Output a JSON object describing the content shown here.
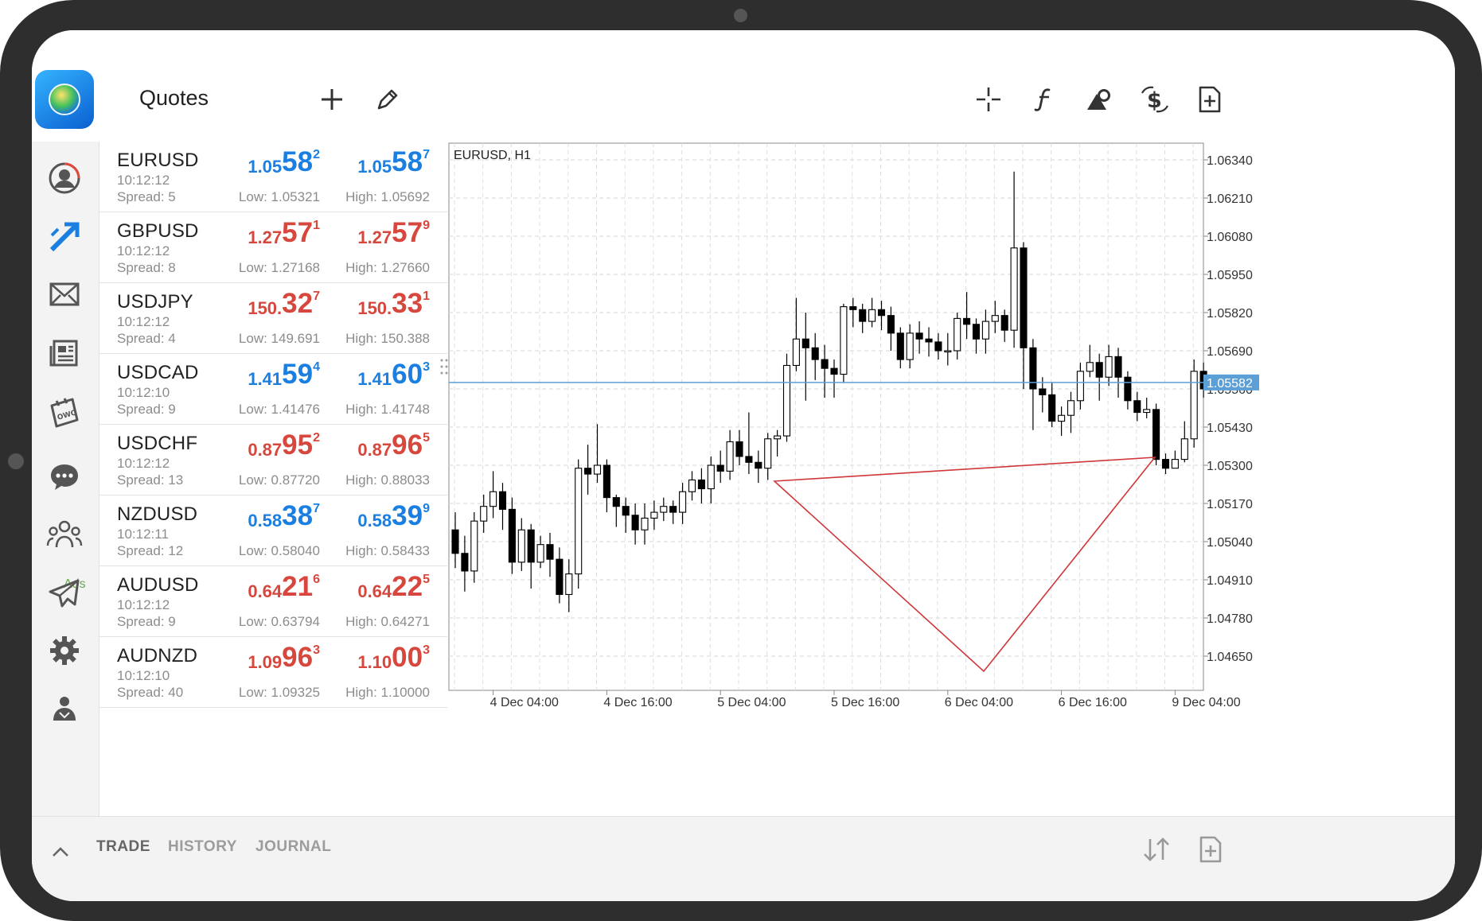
{
  "header": {
    "title": "Quotes",
    "left_icons": [
      "add-icon",
      "edit-icon"
    ],
    "right_icons": [
      "crosshair-icon",
      "indicators-icon",
      "objects-icon",
      "trade-icon",
      "new-order-icon"
    ]
  },
  "nav": {
    "items": [
      "account-icon",
      "trading-icon",
      "mail-icon",
      "news-icon",
      "ads-icon",
      "chat-icon",
      "community-icon",
      "telegram-icon",
      "settings-icon",
      "traders-icon"
    ],
    "ads_label": "Ads"
  },
  "quotes": [
    {
      "symbol": "EURUSD",
      "time": "10:12:12",
      "spread": "Spread: 5",
      "bid": {
        "a": "1.05",
        "b": "58",
        "c": "2"
      },
      "ask": {
        "a": "1.05",
        "b": "58",
        "c": "7"
      },
      "low": "Low: 1.05321",
      "high": "High: 1.05692",
      "color": "#1a7fe0"
    },
    {
      "symbol": "GBPUSD",
      "time": "10:12:12",
      "spread": "Spread: 8",
      "bid": {
        "a": "1.27",
        "b": "57",
        "c": "1"
      },
      "ask": {
        "a": "1.27",
        "b": "57",
        "c": "9"
      },
      "low": "Low: 1.27168",
      "high": "High: 1.27660",
      "color": "#d7473d"
    },
    {
      "symbol": "USDJPY",
      "time": "10:12:12",
      "spread": "Spread: 4",
      "bid": {
        "a": "150.",
        "b": "32",
        "c": "7"
      },
      "ask": {
        "a": "150.",
        "b": "33",
        "c": "1"
      },
      "low": "Low: 149.691",
      "high": "High: 150.388",
      "color": "#d7473d"
    },
    {
      "symbol": "USDCAD",
      "time": "10:12:10",
      "spread": "Spread: 9",
      "bid": {
        "a": "1.41",
        "b": "59",
        "c": "4"
      },
      "ask": {
        "a": "1.41",
        "b": "60",
        "c": "3"
      },
      "low": "Low: 1.41476",
      "high": "High: 1.41748",
      "color": "#1a7fe0"
    },
    {
      "symbol": "USDCHF",
      "time": "10:12:12",
      "spread": "Spread: 13",
      "bid": {
        "a": "0.87",
        "b": "95",
        "c": "2"
      },
      "ask": {
        "a": "0.87",
        "b": "96",
        "c": "5"
      },
      "low": "Low: 0.87720",
      "high": "High: 0.88033",
      "color": "#d7473d"
    },
    {
      "symbol": "NZDUSD",
      "time": "10:12:11",
      "spread": "Spread: 12",
      "bid": {
        "a": "0.58",
        "b": "38",
        "c": "7"
      },
      "ask": {
        "a": "0.58",
        "b": "39",
        "c": "9"
      },
      "low": "Low: 0.58040",
      "high": "High: 0.58433",
      "color": "#1a7fe0"
    },
    {
      "symbol": "AUDUSD",
      "time": "10:12:12",
      "spread": "Spread: 9",
      "bid": {
        "a": "0.64",
        "b": "21",
        "c": "6"
      },
      "ask": {
        "a": "0.64",
        "b": "22",
        "c": "5"
      },
      "low": "Low: 0.63794",
      "high": "High: 0.64271",
      "color": "#d7473d"
    },
    {
      "symbol": "AUDNZD",
      "time": "10:12:10",
      "spread": "Spread: 40",
      "bid": {
        "a": "1.09",
        "b": "96",
        "c": "3"
      },
      "ask": {
        "a": "1.10",
        "b": "00",
        "c": "3"
      },
      "low": "Low: 1.09325",
      "high": "High: 1.10000",
      "color": "#d7473d"
    }
  ],
  "chart": {
    "label": "EURUSD, H1",
    "current_price": "1.05582",
    "price_line_color": "#5b9fd6",
    "y_ticks": [
      "1.06340",
      "1.06210",
      "1.06080",
      "1.05950",
      "1.05820",
      "1.05690",
      "1.05560",
      "1.05430",
      "1.05300",
      "1.05170",
      "1.05040",
      "1.04910",
      "1.04780",
      "1.04650"
    ],
    "x_ticks": [
      "4 Dec 04:00",
      "4 Dec 16:00",
      "5 Dec 04:00",
      "5 Dec 16:00",
      "6 Dec 04:00",
      "6 Dec 16:00",
      "9 Dec 04:00"
    ]
  },
  "chart_data": {
    "type": "candlestick",
    "title": "EURUSD, H1",
    "ylim": [
      1.0455,
      1.064
    ],
    "x_start": "4 Dec 00:00",
    "x_step_hours": 1,
    "candles": [
      [
        1.0508,
        1.05,
        1.0514,
        1.0495
      ],
      [
        1.05,
        1.0494,
        1.0506,
        1.0487
      ],
      [
        1.0494,
        1.0511,
        1.0514,
        1.049
      ],
      [
        1.0511,
        1.0516,
        1.052,
        1.0507
      ],
      [
        1.0516,
        1.0521,
        1.0528,
        1.0512
      ],
      [
        1.0521,
        1.0515,
        1.0524,
        1.0508
      ],
      [
        1.0515,
        1.0497,
        1.0519,
        1.0493
      ],
      [
        1.0497,
        1.0508,
        1.0512,
        1.0494
      ],
      [
        1.0508,
        1.0497,
        1.051,
        1.0488
      ],
      [
        1.0497,
        1.0503,
        1.0506,
        1.0495
      ],
      [
        1.0503,
        1.0498,
        1.0507,
        1.0492
      ],
      [
        1.0498,
        1.0486,
        1.0502,
        1.0483
      ],
      [
        1.0486,
        1.0493,
        1.0498,
        1.048
      ],
      [
        1.0493,
        1.0529,
        1.0532,
        1.0488
      ],
      [
        1.0529,
        1.0527,
        1.0537,
        1.052
      ],
      [
        1.0527,
        1.053,
        1.0544,
        1.0524
      ],
      [
        1.053,
        1.0519,
        1.0532,
        1.0514
      ],
      [
        1.0519,
        1.0516,
        1.052,
        1.0509
      ],
      [
        1.0516,
        1.0513,
        1.0519,
        1.0507
      ],
      [
        1.0513,
        1.0508,
        1.0517,
        1.0503
      ],
      [
        1.0508,
        1.0512,
        1.0517,
        1.0503
      ],
      [
        1.0512,
        1.0514,
        1.0518,
        1.0508
      ],
      [
        1.0514,
        1.0516,
        1.0519,
        1.0511
      ],
      [
        1.0516,
        1.0514,
        1.0518,
        1.051
      ],
      [
        1.0514,
        1.0521,
        1.0524,
        1.051
      ],
      [
        1.0521,
        1.0525,
        1.0528,
        1.0518
      ],
      [
        1.0525,
        1.0522,
        1.0529,
        1.0517
      ],
      [
        1.0522,
        1.053,
        1.0533,
        1.0517
      ],
      [
        1.053,
        1.0528,
        1.0535,
        1.0524
      ],
      [
        1.0528,
        1.0538,
        1.0542,
        1.0525
      ],
      [
        1.0538,
        1.0533,
        1.0542,
        1.053
      ],
      [
        1.0533,
        1.0531,
        1.0548,
        1.0527
      ],
      [
        1.0531,
        1.0529,
        1.0535,
        1.0524
      ],
      [
        1.0529,
        1.0539,
        1.0541,
        1.0525
      ],
      [
        1.0539,
        1.054,
        1.0542,
        1.0533
      ],
      [
        1.054,
        1.0564,
        1.0568,
        1.0538
      ],
      [
        1.0564,
        1.0573,
        1.0587,
        1.0562
      ],
      [
        1.0573,
        1.057,
        1.0582,
        1.0552
      ],
      [
        1.057,
        1.0566,
        1.0575,
        1.0559
      ],
      [
        1.0566,
        1.0563,
        1.0571,
        1.0553
      ],
      [
        1.0563,
        1.0561,
        1.0566,
        1.0553
      ],
      [
        1.0561,
        1.0584,
        1.0585,
        1.0558
      ],
      [
        1.0584,
        1.0583,
        1.0587,
        1.0577
      ],
      [
        1.0583,
        1.0579,
        1.0585,
        1.0575
      ],
      [
        1.0579,
        1.0583,
        1.0587,
        1.0577
      ],
      [
        1.0583,
        1.0581,
        1.0586,
        1.0576
      ],
      [
        1.0581,
        1.0575,
        1.0584,
        1.0569
      ],
      [
        1.0575,
        1.0566,
        1.0577,
        1.0563
      ],
      [
        1.0566,
        1.0575,
        1.0578,
        1.0563
      ],
      [
        1.0575,
        1.0573,
        1.0579,
        1.0568
      ],
      [
        1.0573,
        1.0572,
        1.0577,
        1.0567
      ],
      [
        1.0572,
        1.0569,
        1.0575,
        1.0566
      ],
      [
        1.0569,
        1.0569,
        1.0575,
        1.0564
      ],
      [
        1.0569,
        1.058,
        1.0582,
        1.0566
      ],
      [
        1.058,
        1.0578,
        1.0589,
        1.0573
      ],
      [
        1.0578,
        1.0573,
        1.058,
        1.0568
      ],
      [
        1.0573,
        1.0579,
        1.0583,
        1.0568
      ],
      [
        1.0579,
        1.0581,
        1.0586,
        1.0575
      ],
      [
        1.0581,
        1.0576,
        1.0583,
        1.0572
      ],
      [
        1.0576,
        1.0604,
        1.063,
        1.057
      ],
      [
        1.0604,
        1.057,
        1.0606,
        1.0556
      ],
      [
        1.057,
        1.0556,
        1.0573,
        1.0542
      ],
      [
        1.0556,
        1.0554,
        1.056,
        1.0548
      ],
      [
        1.0554,
        1.0545,
        1.0558,
        1.0543
      ],
      [
        1.0545,
        1.0547,
        1.055,
        1.054
      ],
      [
        1.0547,
        1.0552,
        1.0555,
        1.0541
      ],
      [
        1.0552,
        1.0562,
        1.0565,
        1.0549
      ],
      [
        1.0562,
        1.0565,
        1.0571,
        1.056
      ],
      [
        1.0565,
        1.056,
        1.0568,
        1.0552
      ],
      [
        1.056,
        1.0567,
        1.0571,
        1.0557
      ],
      [
        1.0567,
        1.056,
        1.057,
        1.0553
      ],
      [
        1.056,
        1.0552,
        1.0562,
        1.0549
      ],
      [
        1.0552,
        1.0548,
        1.0555,
        1.0545
      ],
      [
        1.0548,
        1.0549,
        1.0553,
        1.0546
      ],
      [
        1.0549,
        1.0532,
        1.0551,
        1.053
      ],
      [
        1.0532,
        1.0529,
        1.0534,
        1.0527
      ],
      [
        1.0529,
        1.0532,
        1.0535,
        1.0529
      ],
      [
        1.0532,
        1.0539,
        1.0545,
        1.0531
      ],
      [
        1.0539,
        1.0562,
        1.0566,
        1.0536
      ],
      [
        1.0562,
        1.0556,
        1.0565,
        1.0553
      ]
    ]
  },
  "bottom": {
    "toggle_icon": "chevron-up-icon",
    "tabs": [
      {
        "label": "TRADE",
        "active": true
      },
      {
        "label": "HISTORY",
        "active": false
      },
      {
        "label": "JOURNAL",
        "active": false
      }
    ],
    "right_icons": [
      "sort-icon",
      "new-order-icon"
    ]
  }
}
